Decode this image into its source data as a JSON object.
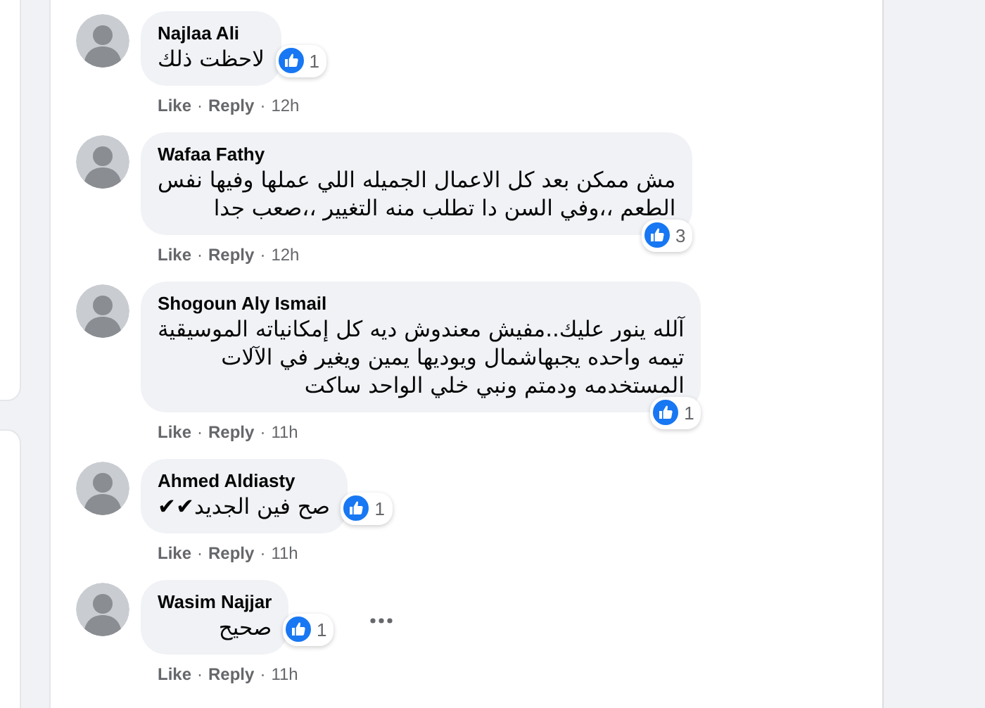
{
  "comments": [
    {
      "author": "Najlaa Ali",
      "text_lines": [
        "لاحظت ذلك"
      ],
      "reaction_count": "1",
      "has_more": false,
      "actions": [
        {
          "kind": "link",
          "text": "Like"
        },
        {
          "kind": "sep",
          "text": "·"
        },
        {
          "kind": "link",
          "text": "Reply"
        },
        {
          "kind": "sep",
          "text": "·"
        },
        {
          "kind": "time",
          "text": "12h"
        }
      ]
    },
    {
      "author": "Wafaa Fathy",
      "text_lines": [
        "مش ممكن بعد كل الاعمال الجميله اللي عملها وفيها نفس",
        "الطعم ،،وفي السن دا تطلب منه التغيير ،،صعب جدا"
      ],
      "reaction_count": "3",
      "has_more": false,
      "actions": [
        {
          "kind": "link",
          "text": "Like"
        },
        {
          "kind": "sep",
          "text": "·"
        },
        {
          "kind": "link",
          "text": "Reply"
        },
        {
          "kind": "sep",
          "text": "·"
        },
        {
          "kind": "time",
          "text": "12h"
        }
      ]
    },
    {
      "author": "Shogoun Aly Ismail",
      "text_lines": [
        "آلله ينور عليك..مفيش معندوش ديه كل إمكانياته الموسيقية",
        "تيمه واحده يجبهاشمال ويوديها يمين ويغير في الآلات",
        "المستخدمه ودمتم ونبي خلي الواحد ساكت"
      ],
      "reaction_count": "1",
      "has_more": false,
      "actions": [
        {
          "kind": "link",
          "text": "Like"
        },
        {
          "kind": "sep",
          "text": "·"
        },
        {
          "kind": "link",
          "text": "Reply"
        },
        {
          "kind": "sep",
          "text": "·"
        },
        {
          "kind": "time",
          "text": "11h"
        }
      ]
    },
    {
      "author": "Ahmed Aldiasty",
      "text_lines": [
        "صح فين الجديد✔✔"
      ],
      "reaction_count": "1",
      "has_more": false,
      "actions": [
        {
          "kind": "link",
          "text": "Like"
        },
        {
          "kind": "sep",
          "text": "·"
        },
        {
          "kind": "link",
          "text": "Reply"
        },
        {
          "kind": "sep",
          "text": "·"
        },
        {
          "kind": "time",
          "text": "11h"
        }
      ]
    },
    {
      "author": "Wasim Najjar",
      "text_lines": [
        "صحيح"
      ],
      "reaction_count": "1",
      "has_more": true,
      "actions": [
        {
          "kind": "link",
          "text": "Like"
        },
        {
          "kind": "sep",
          "text": "·"
        },
        {
          "kind": "link",
          "text": "Reply"
        },
        {
          "kind": "sep",
          "text": "·"
        },
        {
          "kind": "time",
          "text": "11h"
        }
      ]
    }
  ]
}
